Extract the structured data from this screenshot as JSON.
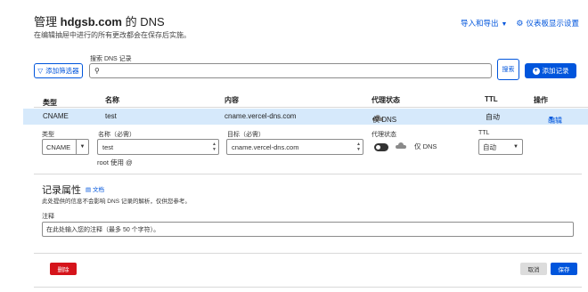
{
  "header": {
    "title_prefix": "管理",
    "domain": "hdgsb.com",
    "title_suffix": "的 DNS",
    "subtitle": "在编辑抽屉中进行的所有更改都会在保存后实施。",
    "import_export_label": "导入和导出",
    "dashboard_settings_label": "仪表板显示设置"
  },
  "search": {
    "label": "搜索 DNS 记录",
    "value": "",
    "placeholder": "",
    "filter_button_label": "添加筛选器",
    "search_button_label": "搜索",
    "add_record_label": "添加记录"
  },
  "table": {
    "columns": {
      "type": "类型",
      "name": "名称",
      "content": "内容",
      "proxy_status": "代理状态",
      "ttl": "TTL",
      "actions": "操作"
    },
    "rows": [
      {
        "type": "CNAME",
        "name": "test",
        "content": "cname.vercel-dns.com",
        "proxy_status": "仅 DNS",
        "ttl": "自动",
        "action_label": "编辑"
      }
    ]
  },
  "edit_form": {
    "type_label": "类型",
    "type_value": "CNAME",
    "name_label": "名称（必需）",
    "name_value": "test",
    "name_hint": "root 使用 @",
    "target_label": "目标（必需）",
    "target_value": "cname.vercel-dns.com",
    "proxy_label": "代理状态",
    "proxy_value": "仅 DNS",
    "ttl_label": "TTL",
    "ttl_value": "自动"
  },
  "record_attributes": {
    "title": "记录属性",
    "doc_link": "文档",
    "description": "此处提供的信息不会影响 DNS 记录的解析，仅供您参考。",
    "note_label": "注释",
    "note_placeholder": "在此处输入您的注释（最多 50 个字符）。"
  },
  "buttons": {
    "delete": "删除",
    "cancel": "取消",
    "save": "保存"
  },
  "colors": {
    "accent": "#0055dc",
    "danger": "#d5141b",
    "selected_row": "#d6e9fb"
  }
}
